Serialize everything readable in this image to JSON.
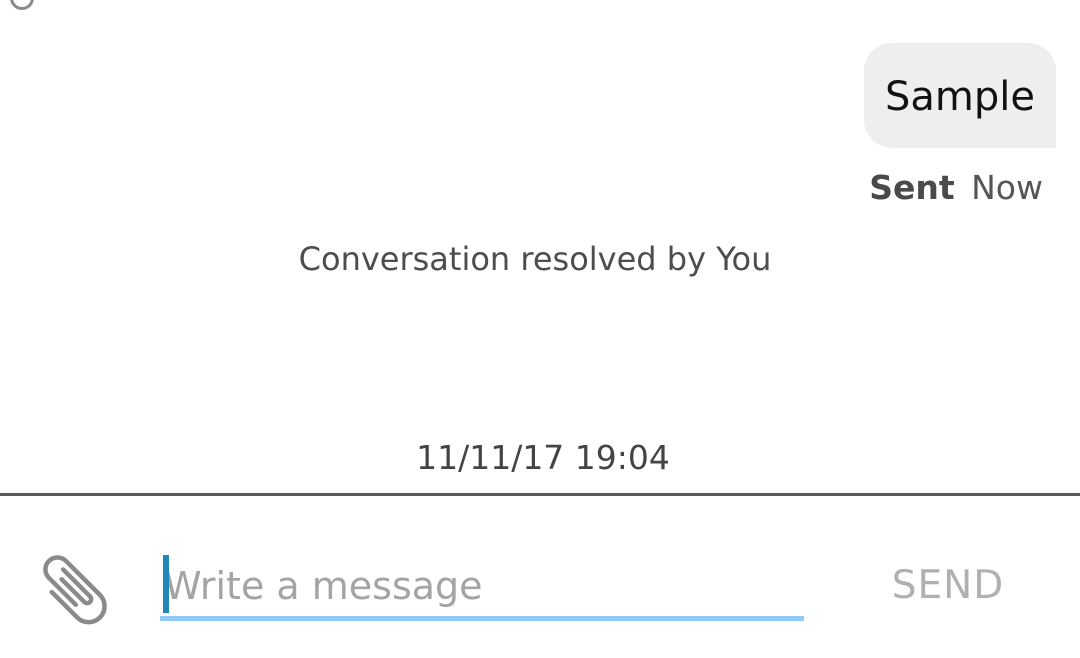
{
  "conversation": {
    "sent_message": {
      "text": "Sample",
      "status_label": "Sent",
      "status_time": "Now"
    },
    "system_message": "Conversation resolved by You",
    "timestamp": "11/11/17 19:04"
  },
  "composer": {
    "placeholder": "Write a message",
    "value": "",
    "send_label": "SEND",
    "attach_icon": "paperclip-icon"
  },
  "colors": {
    "bubble": "#eeeeee",
    "accent_underline": "#90caf9",
    "cursor": "#1e88b8",
    "send_disabled": "#b0b0b0"
  }
}
